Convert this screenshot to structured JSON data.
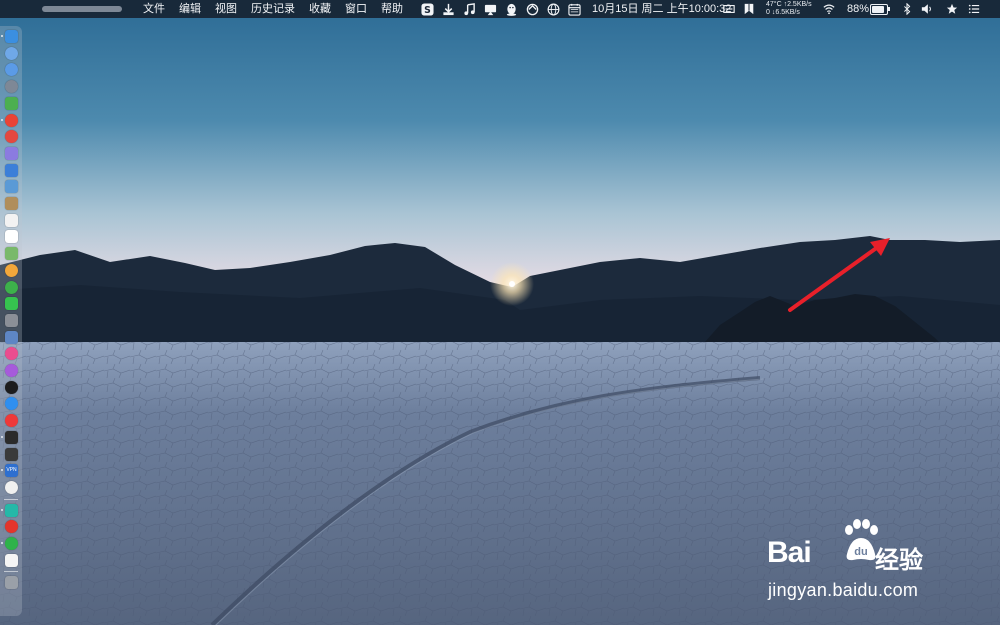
{
  "menubar": {
    "apple_glyph": "",
    "menus": [
      "文件",
      "编辑",
      "视图",
      "历史记录",
      "收藏",
      "窗口",
      "帮助"
    ],
    "tray_icons": [
      "sogou-input-icon",
      "download-icon",
      "music-icon",
      "screen-cast-icon",
      "qq-icon",
      "sync-icon",
      "globe-icon",
      "calendar-icon"
    ],
    "clock": "10月15日 周二 上午10:00:32",
    "stats": {
      "temperature": "47°C",
      "upload": "↑2.5KB/s",
      "zero": "0",
      "download": "↓6.5KB/s"
    },
    "battery_percent": "88%",
    "battery_level": 0.88,
    "right_icons": [
      "bluetooth-icon",
      "volume-icon",
      "star-icon",
      "list-icon"
    ]
  },
  "dock": {
    "icons": [
      {
        "name": "finder-icon",
        "color": "#3b8fe0"
      },
      {
        "name": "siri-icon",
        "color": "#6fa8e8"
      },
      {
        "name": "safari-icon",
        "color": "#5b9be6"
      },
      {
        "name": "launchpad-icon",
        "color": "#7e8896"
      },
      {
        "name": "android-studio-icon",
        "color": "#4caf50"
      },
      {
        "name": "chrome-icon",
        "color": "#e94335"
      },
      {
        "name": "music-app-icon",
        "color": "#e4483f"
      },
      {
        "name": "notes-app-icon",
        "color": "#8b7be0"
      },
      {
        "name": "xcode-icon",
        "color": "#3c7fd8"
      },
      {
        "name": "preview-icon",
        "color": "#5a9ad6"
      },
      {
        "name": "contacts-icon",
        "color": "#b08e5b"
      },
      {
        "name": "calendar-app-icon",
        "color": "#f2f2f2"
      },
      {
        "name": "reminders-icon",
        "color": "#ffffff"
      },
      {
        "name": "maps-icon",
        "color": "#79b96a"
      },
      {
        "name": "photos-icon",
        "color": "#f2a73b"
      },
      {
        "name": "messages-icon",
        "color": "#3db14b"
      },
      {
        "name": "facetime-icon",
        "color": "#36c24f"
      },
      {
        "name": "system-prefs-icon",
        "color": "#8b8f97"
      },
      {
        "name": "airdrop-icon",
        "color": "#5e86c4"
      },
      {
        "name": "itunes-icon",
        "color": "#ea4d8f"
      },
      {
        "name": "podcasts-icon",
        "color": "#a65bdb"
      },
      {
        "name": "apple-tv-icon",
        "color": "#1c1c1e"
      },
      {
        "name": "app-store-icon",
        "color": "#2f8ff0"
      },
      {
        "name": "vivaldi-icon",
        "color": "#ef3939"
      },
      {
        "name": "terminal-icon",
        "color": "#2b2b2b"
      },
      {
        "name": "activity-monitor-icon",
        "color": "#3a3a3a"
      },
      {
        "name": "vpn-icon",
        "color": "#2e6fd0"
      },
      {
        "name": "yandex-icon",
        "color": "#f0f0f0"
      },
      {
        "name": "feishu-icon",
        "color": "#25b8a8"
      },
      {
        "name": "netease-music-icon",
        "color": "#e4352c"
      },
      {
        "name": "wechat-icon",
        "color": "#2eb34a"
      },
      {
        "name": "docs-icon",
        "color": "#f5f5f5"
      },
      {
        "name": "trash-icon",
        "color": "#9aa0a8"
      }
    ],
    "labels": {
      "vpn_icon_text": "VPN"
    }
  },
  "watermark": {
    "brand": "Bai",
    "brand_suffix": "du",
    "product": "经验",
    "url": "jingyan.baidu.com"
  },
  "colors": {
    "arrow": "#e8202a",
    "sky_top": "#2e6d97",
    "sky_horizon": "#f1dfe6"
  }
}
